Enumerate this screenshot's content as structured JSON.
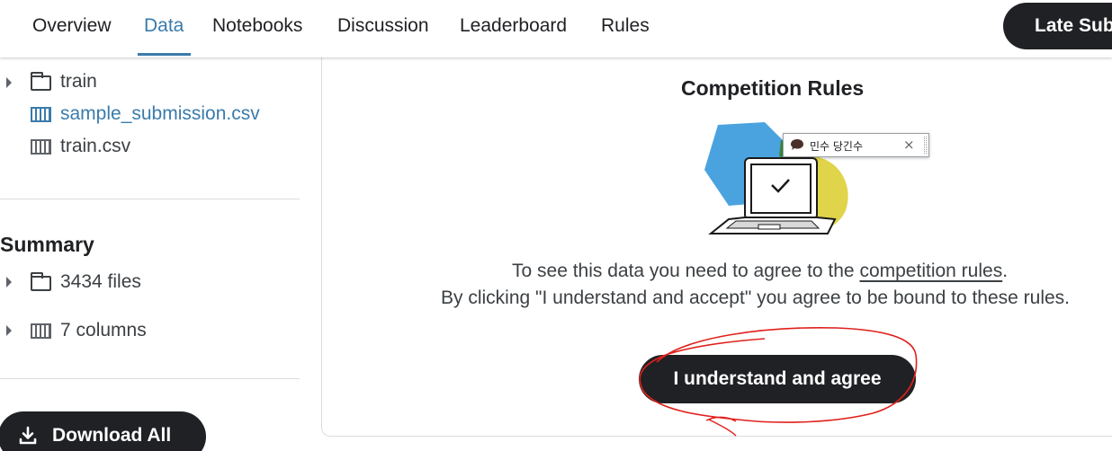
{
  "nav": {
    "tabs": [
      {
        "label": "Overview"
      },
      {
        "label": "Data"
      },
      {
        "label": "Notebooks"
      },
      {
        "label": "Discussion"
      },
      {
        "label": "Leaderboard"
      },
      {
        "label": "Rules"
      }
    ],
    "active_tab": "Data",
    "late_submission_label": "Late Sub"
  },
  "sidebar": {
    "files": [
      {
        "name": "train",
        "icon": "folder-icon"
      },
      {
        "name": "sample_submission.csv",
        "icon": "table-icon"
      },
      {
        "name": "train.csv",
        "icon": "table-icon"
      }
    ],
    "summary_title": "Summary",
    "summary_items": [
      {
        "label": "3434 files",
        "icon": "folder-icon"
      },
      {
        "label": "7 columns",
        "icon": "table-icon"
      }
    ],
    "download_label": "Download All"
  },
  "main": {
    "title": "Competition Rules",
    "text_before_link": "To see this data you need to agree to the ",
    "link_text": "competition rules",
    "text_after_link": ".",
    "line2": "By clicking \"I understand and accept\" you agree to be bound to these rules.",
    "agree_button": "I understand and agree"
  },
  "tooltip": {
    "text": "민수 당긴수",
    "close": "×"
  },
  "colors": {
    "accent": "#3a7bab",
    "button_dark": "#202124",
    "annotation_red": "#e0201c",
    "illustration_blue": "#4aa3df",
    "illustration_yellow": "#e0d44a",
    "illustration_green": "#3b8a3a"
  }
}
